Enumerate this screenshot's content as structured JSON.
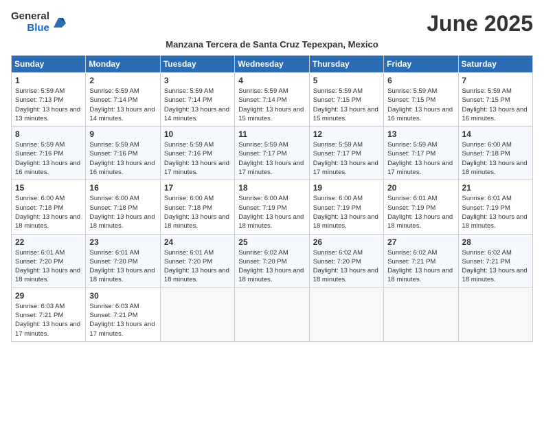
{
  "header": {
    "logo_general": "General",
    "logo_blue": "Blue",
    "month_title": "June 2025",
    "subtitle": "Manzana Tercera de Santa Cruz Tepexpan, Mexico"
  },
  "weekdays": [
    "Sunday",
    "Monday",
    "Tuesday",
    "Wednesday",
    "Thursday",
    "Friday",
    "Saturday"
  ],
  "weeks": [
    [
      {
        "day": "1",
        "sunrise": "5:59 AM",
        "sunset": "7:13 PM",
        "daylight": "13 hours and 13 minutes."
      },
      {
        "day": "2",
        "sunrise": "5:59 AM",
        "sunset": "7:14 PM",
        "daylight": "13 hours and 14 minutes."
      },
      {
        "day": "3",
        "sunrise": "5:59 AM",
        "sunset": "7:14 PM",
        "daylight": "13 hours and 14 minutes."
      },
      {
        "day": "4",
        "sunrise": "5:59 AM",
        "sunset": "7:14 PM",
        "daylight": "13 hours and 15 minutes."
      },
      {
        "day": "5",
        "sunrise": "5:59 AM",
        "sunset": "7:15 PM",
        "daylight": "13 hours and 15 minutes."
      },
      {
        "day": "6",
        "sunrise": "5:59 AM",
        "sunset": "7:15 PM",
        "daylight": "13 hours and 16 minutes."
      },
      {
        "day": "7",
        "sunrise": "5:59 AM",
        "sunset": "7:15 PM",
        "daylight": "13 hours and 16 minutes."
      }
    ],
    [
      {
        "day": "8",
        "sunrise": "5:59 AM",
        "sunset": "7:16 PM",
        "daylight": "13 hours and 16 minutes."
      },
      {
        "day": "9",
        "sunrise": "5:59 AM",
        "sunset": "7:16 PM",
        "daylight": "13 hours and 16 minutes."
      },
      {
        "day": "10",
        "sunrise": "5:59 AM",
        "sunset": "7:16 PM",
        "daylight": "13 hours and 17 minutes."
      },
      {
        "day": "11",
        "sunrise": "5:59 AM",
        "sunset": "7:17 PM",
        "daylight": "13 hours and 17 minutes."
      },
      {
        "day": "12",
        "sunrise": "5:59 AM",
        "sunset": "7:17 PM",
        "daylight": "13 hours and 17 minutes."
      },
      {
        "day": "13",
        "sunrise": "5:59 AM",
        "sunset": "7:17 PM",
        "daylight": "13 hours and 17 minutes."
      },
      {
        "day": "14",
        "sunrise": "6:00 AM",
        "sunset": "7:18 PM",
        "daylight": "13 hours and 18 minutes."
      }
    ],
    [
      {
        "day": "15",
        "sunrise": "6:00 AM",
        "sunset": "7:18 PM",
        "daylight": "13 hours and 18 minutes."
      },
      {
        "day": "16",
        "sunrise": "6:00 AM",
        "sunset": "7:18 PM",
        "daylight": "13 hours and 18 minutes."
      },
      {
        "day": "17",
        "sunrise": "6:00 AM",
        "sunset": "7:18 PM",
        "daylight": "13 hours and 18 minutes."
      },
      {
        "day": "18",
        "sunrise": "6:00 AM",
        "sunset": "7:19 PM",
        "daylight": "13 hours and 18 minutes."
      },
      {
        "day": "19",
        "sunrise": "6:00 AM",
        "sunset": "7:19 PM",
        "daylight": "13 hours and 18 minutes."
      },
      {
        "day": "20",
        "sunrise": "6:01 AM",
        "sunset": "7:19 PM",
        "daylight": "13 hours and 18 minutes."
      },
      {
        "day": "21",
        "sunrise": "6:01 AM",
        "sunset": "7:19 PM",
        "daylight": "13 hours and 18 minutes."
      }
    ],
    [
      {
        "day": "22",
        "sunrise": "6:01 AM",
        "sunset": "7:20 PM",
        "daylight": "13 hours and 18 minutes."
      },
      {
        "day": "23",
        "sunrise": "6:01 AM",
        "sunset": "7:20 PM",
        "daylight": "13 hours and 18 minutes."
      },
      {
        "day": "24",
        "sunrise": "6:01 AM",
        "sunset": "7:20 PM",
        "daylight": "13 hours and 18 minutes."
      },
      {
        "day": "25",
        "sunrise": "6:02 AM",
        "sunset": "7:20 PM",
        "daylight": "13 hours and 18 minutes."
      },
      {
        "day": "26",
        "sunrise": "6:02 AM",
        "sunset": "7:20 PM",
        "daylight": "13 hours and 18 minutes."
      },
      {
        "day": "27",
        "sunrise": "6:02 AM",
        "sunset": "7:21 PM",
        "daylight": "13 hours and 18 minutes."
      },
      {
        "day": "28",
        "sunrise": "6:02 AM",
        "sunset": "7:21 PM",
        "daylight": "13 hours and 18 minutes."
      }
    ],
    [
      {
        "day": "29",
        "sunrise": "6:03 AM",
        "sunset": "7:21 PM",
        "daylight": "13 hours and 17 minutes."
      },
      {
        "day": "30",
        "sunrise": "6:03 AM",
        "sunset": "7:21 PM",
        "daylight": "13 hours and 17 minutes."
      },
      null,
      null,
      null,
      null,
      null
    ]
  ],
  "labels": {
    "sunrise": "Sunrise:",
    "sunset": "Sunset:",
    "daylight": "Daylight:"
  }
}
